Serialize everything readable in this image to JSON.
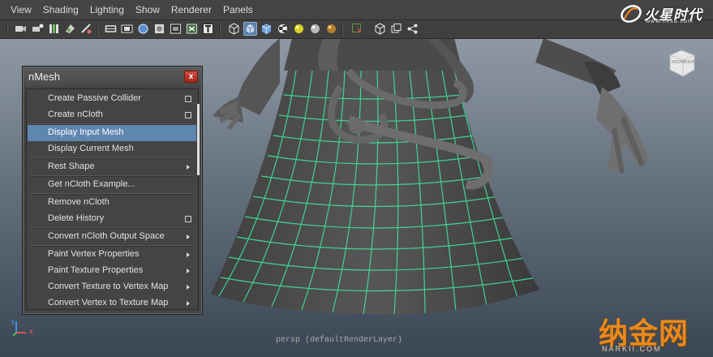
{
  "menubar": {
    "items": [
      "View",
      "Shading",
      "Lighting",
      "Show",
      "Renderer",
      "Panels"
    ]
  },
  "toolbar": {
    "icons": [
      "camera-select",
      "camera-attributes",
      "bookmarks",
      "image-plane",
      "grid",
      "film-gate",
      "resolution-gate",
      "wireframe-shaded",
      "xray",
      "isolate-select",
      "hud",
      "texture",
      "cube-wire",
      "cube-shaded",
      "cube-smooth",
      "checker",
      "light-sphere-yellow",
      "light-sphere-gray",
      "light-sphere-gold",
      "select-highlight",
      "two-panes",
      "share-node"
    ],
    "active": [
      "cube-shaded"
    ]
  },
  "nmesh_window": {
    "title": "nMesh",
    "close_glyph": "x",
    "items": [
      {
        "label": "Create Passive Collider",
        "suffix": "option"
      },
      {
        "label": "Create nCloth",
        "suffix": "option"
      },
      {
        "label": "Display Input Mesh",
        "suffix": "none",
        "highlighted": true
      },
      {
        "label": "Display Current Mesh",
        "suffix": "none"
      },
      {
        "label": "Rest Shape",
        "suffix": "submenu"
      },
      {
        "label": "Get nCloth Example...",
        "suffix": "none"
      },
      {
        "label": "Remove nCloth",
        "suffix": "none"
      },
      {
        "label": "Delete History",
        "suffix": "option"
      },
      {
        "label": "Convert nCloth Output Space",
        "suffix": "submenu"
      },
      {
        "label": "Paint Vertex Properties",
        "suffix": "submenu"
      },
      {
        "label": "Paint Texture Properties",
        "suffix": "submenu"
      },
      {
        "label": "Convert Texture to Vertex Map",
        "suffix": "submenu"
      },
      {
        "label": "Convert Vertex to Texture Map",
        "suffix": "submenu"
      }
    ]
  },
  "viewport": {
    "camera_label": "persp (defaultRenderLayer)",
    "viewcube": {
      "front": "FRONT",
      "right": "RIGHT"
    },
    "axis": {
      "y": "y",
      "x": "x"
    }
  },
  "watermarks": {
    "top_title": "火星时代",
    "top_url": "www.hxsd.com",
    "bottom_title": "纳金网",
    "bottom_url": "NARKII.COM"
  },
  "colors": {
    "ui_bg": "#444444",
    "highlight": "#5f86af",
    "wireframe": "#3fe39a",
    "viewport_top": "#8f9aa6",
    "viewport_bottom": "#3a4654"
  }
}
